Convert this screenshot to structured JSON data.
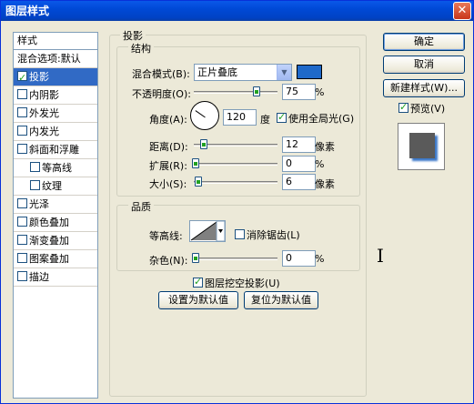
{
  "window": {
    "title": "图层样式",
    "close_glyph": "✕"
  },
  "style_list": {
    "header": "样式",
    "items": [
      {
        "label": "混合选项:默认",
        "checkbox": false,
        "checked": false,
        "indent": false,
        "selected": false
      },
      {
        "label": "投影",
        "checkbox": true,
        "checked": true,
        "indent": false,
        "selected": true
      },
      {
        "label": "内阴影",
        "checkbox": true,
        "checked": false,
        "indent": false,
        "selected": false
      },
      {
        "label": "外发光",
        "checkbox": true,
        "checked": false,
        "indent": false,
        "selected": false
      },
      {
        "label": "内发光",
        "checkbox": true,
        "checked": false,
        "indent": false,
        "selected": false
      },
      {
        "label": "斜面和浮雕",
        "checkbox": true,
        "checked": false,
        "indent": false,
        "selected": false
      },
      {
        "label": "等高线",
        "checkbox": true,
        "checked": false,
        "indent": true,
        "selected": false
      },
      {
        "label": "纹理",
        "checkbox": true,
        "checked": false,
        "indent": true,
        "selected": false
      },
      {
        "label": "光泽",
        "checkbox": true,
        "checked": false,
        "indent": false,
        "selected": false
      },
      {
        "label": "颜色叠加",
        "checkbox": true,
        "checked": false,
        "indent": false,
        "selected": false
      },
      {
        "label": "渐变叠加",
        "checkbox": true,
        "checked": false,
        "indent": false,
        "selected": false
      },
      {
        "label": "图案叠加",
        "checkbox": true,
        "checked": false,
        "indent": false,
        "selected": false
      },
      {
        "label": "描边",
        "checkbox": true,
        "checked": false,
        "indent": false,
        "selected": false
      }
    ]
  },
  "drop_shadow": {
    "title": "投影",
    "structure": {
      "title": "结构",
      "blend_mode_label": "混合模式(B):",
      "blend_mode_value": "正片叠底",
      "shadow_color": "#1f69c9",
      "opacity_label": "不透明度(O):",
      "opacity_value": "75",
      "opacity_unit": "%",
      "opacity_fraction": 0.75,
      "angle_label": "角度(A):",
      "angle_value": "120",
      "angle_unit": "度",
      "global_light_label": "使用全局光(G)",
      "global_light_checked": true,
      "distance_label": "距离(D):",
      "distance_value": "12",
      "distance_unit": "像素",
      "spread_label": "扩展(R):",
      "spread_value": "0",
      "spread_unit": "%",
      "size_label": "大小(S):",
      "size_value": "6",
      "size_unit": "像素"
    },
    "quality": {
      "title": "品质",
      "contour_label": "等高线:",
      "antialias_label": "消除锯齿(L)",
      "antialias_checked": false,
      "noise_label": "杂色(N):",
      "noise_value": "0",
      "noise_unit": "%"
    },
    "knockout_label": "图层挖空投影(U)",
    "knockout_checked": true,
    "set_default_label": "设置为默认值",
    "reset_default_label": "复位为默认值"
  },
  "buttons": {
    "ok": "确定",
    "cancel": "取消",
    "new_style": "新建样式(W)...",
    "preview_label": "预览(V)",
    "preview_checked": true
  },
  "icons": {
    "close": "close-icon",
    "combo_arrow": "chevron-down-icon",
    "text_cursor": "i-beam-cursor-icon"
  }
}
